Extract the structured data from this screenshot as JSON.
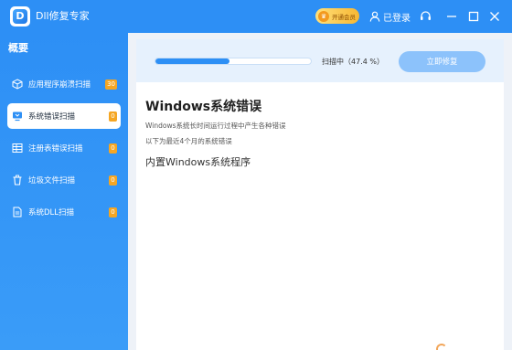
{
  "app": {
    "title": "Dll修复专家"
  },
  "header": {
    "vip_label": "开通会员",
    "login_label": "已登录"
  },
  "sidebar": {
    "heading": "概要",
    "items": [
      {
        "label": "应用程序崩溃扫描",
        "count": "30",
        "icon": "cube-icon",
        "active": false
      },
      {
        "label": "系统错误扫描",
        "count": "0",
        "icon": "monitor-icon",
        "active": true
      },
      {
        "label": "注册表错误扫描",
        "count": "0",
        "icon": "table-grid-icon",
        "active": false
      },
      {
        "label": "垃圾文件扫描",
        "count": "0",
        "icon": "trash-icon",
        "active": false
      },
      {
        "label": "系统DLL扫描",
        "count": "0",
        "icon": "file-icon",
        "active": false
      }
    ]
  },
  "scan": {
    "progress_percent": 47.4,
    "status_text": "扫描中（47.4 %）",
    "repair_button_label": "立即修复"
  },
  "content": {
    "title": "Windows系统错误",
    "description_1": "Windows系统长时间运行过程中产生各种错误",
    "description_2": "以下为最近4个月的系统错误",
    "item_1": "内置Windows系统程序"
  },
  "colors": {
    "brand_blue": "#2d8ff5",
    "badge_orange": "#f5a623",
    "button_light_blue": "#8cc2fb"
  }
}
